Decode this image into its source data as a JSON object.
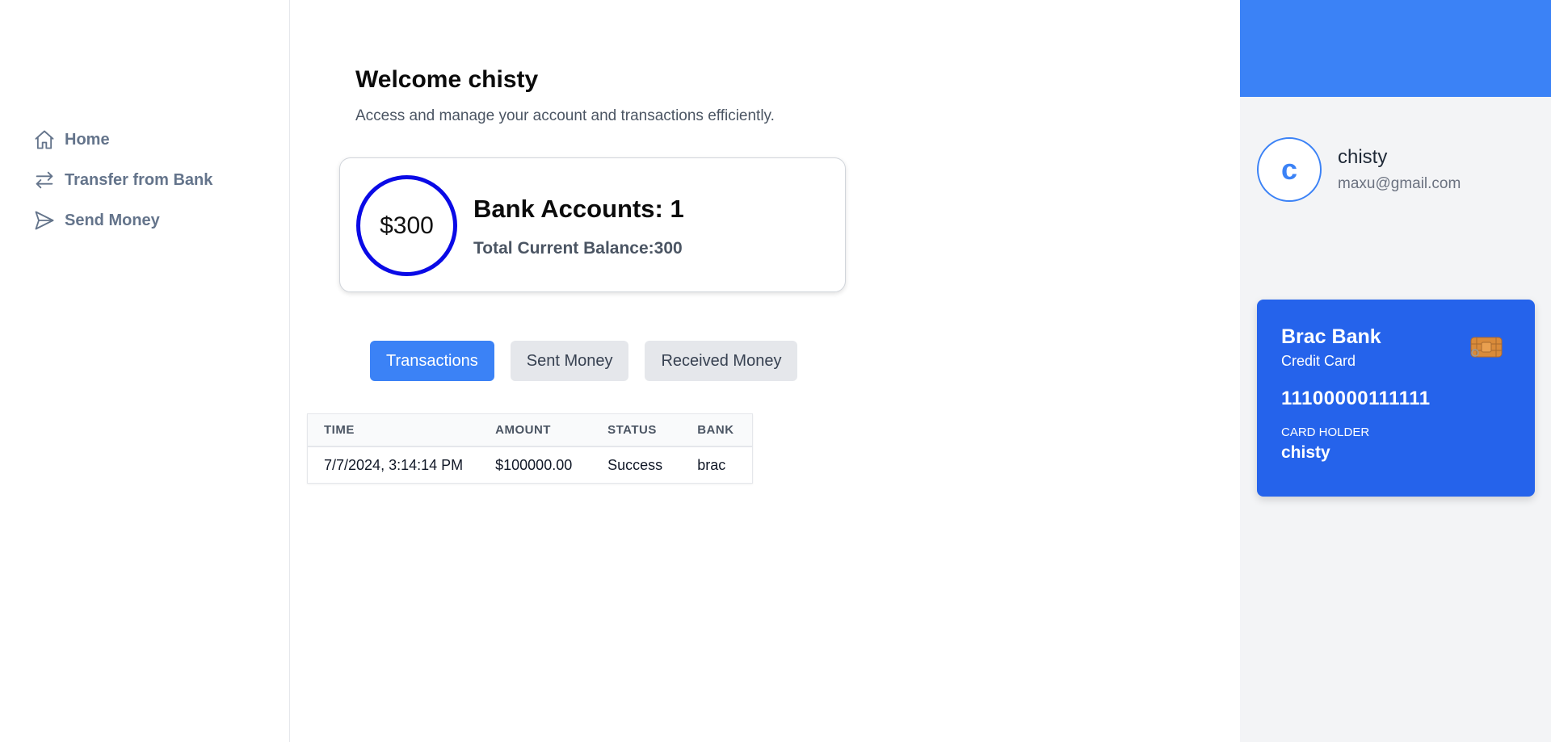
{
  "sidebar": {
    "items": [
      {
        "label": "Home",
        "icon": "home-icon"
      },
      {
        "label": "Transfer from Bank",
        "icon": "transfer-icon"
      },
      {
        "label": "Send Money",
        "icon": "send-icon"
      }
    ]
  },
  "main": {
    "welcome": "Welcome chisty",
    "subtitle": "Access and manage your account and transactions efficiently.",
    "summary": {
      "balance_circle": "$300",
      "accounts_title": "Bank Accounts: 1",
      "total_balance": "Total Current Balance:300"
    },
    "tabs": [
      {
        "label": "Transactions",
        "active": true
      },
      {
        "label": "Sent Money",
        "active": false
      },
      {
        "label": "Received Money",
        "active": false
      }
    ],
    "table": {
      "columns": [
        "TIME",
        "AMOUNT",
        "STATUS",
        "BANK"
      ],
      "rows": [
        [
          "7/7/2024, 3:14:14 PM",
          "$100000.00",
          "Success",
          "brac"
        ]
      ]
    }
  },
  "profile": {
    "initial": "c",
    "name": "chisty",
    "email": "maxu@gmail.com"
  },
  "card": {
    "bank_name": "Brac Bank",
    "card_type": "Credit Card",
    "number": "11100000111111",
    "holder_label": "CARD HOLDER",
    "holder_name": "chisty",
    "icon": "card-chip-icon"
  },
  "colors": {
    "accent": "#3b82f6",
    "card": "#2563eb",
    "circle": "#0a0ae6",
    "panel": "#f3f4f6"
  }
}
